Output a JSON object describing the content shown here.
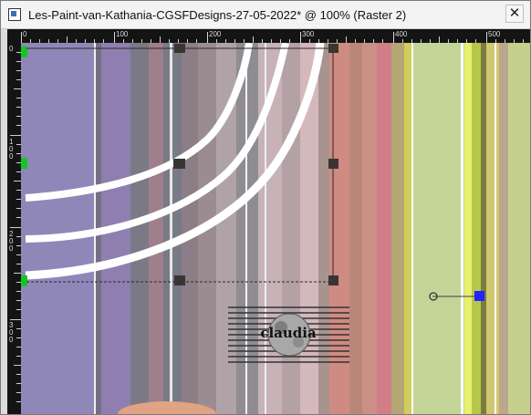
{
  "window": {
    "title": "Les-Paint-van-Kathania-CGSFDesigns-27-05-2022* @ 100% (Raster 2)",
    "close_label": "✕"
  },
  "ruler": {
    "top_labels": [
      "0",
      "100",
      "200",
      "300",
      "400",
      "500"
    ],
    "left_labels": [
      "0",
      "100",
      "200",
      "300"
    ]
  },
  "watermark": {
    "text": "claudia"
  },
  "icons": {
    "app": "app-window-icon",
    "close": "close-icon",
    "rotation": "rotation-handle-icon"
  },
  "colors": {
    "selection": "#2c2927",
    "green_marker": "#10c820",
    "blue_handle": "#2323ff"
  }
}
